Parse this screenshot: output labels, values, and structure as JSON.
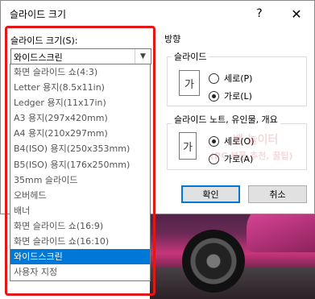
{
  "window": {
    "title": "슬라이드 크기",
    "help_glyph": "?",
    "close_glyph": "✕"
  },
  "size": {
    "label": "슬라이드 크기(S):",
    "selected_value": "와이드스크린",
    "options": [
      "화면 슬라이드 쇼(4:3)",
      "Letter 용지(8.5x11in)",
      "Ledger 용지(11x17in)",
      "A3 용지(297x420mm)",
      "A4 용지(210x297mm)",
      "B4(ISO) 용지(250x353mm)",
      "B5(ISO) 용지(176x250mm)",
      "35mm 슬라이드",
      "오버헤드",
      "배너",
      "화면 슬라이드 쇼(16:9)",
      "화면 슬라이드 쇼(16:10)",
      "와이드스크린",
      "사용자 지정"
    ]
  },
  "orientation": {
    "title": "방향",
    "slides": {
      "label": "슬라이드",
      "icon_glyph": "가",
      "portrait": "세로(P)",
      "landscape": "가로(L)",
      "selected": "landscape"
    },
    "notes": {
      "label": "슬라이드 노트, 유인물, 개요",
      "icon_glyph": "가",
      "portrait": "세로(O)",
      "landscape": "가로(A)",
      "selected": "portrait"
    }
  },
  "buttons": {
    "ok": "확인",
    "cancel": "취소"
  },
  "watermark": {
    "line1": "밴 놀이터",
    "line2": "(PC 부품 추천, 꿀팁)"
  },
  "colors": {
    "accent": "#0078d7",
    "highlight_frame": "#e01818"
  }
}
